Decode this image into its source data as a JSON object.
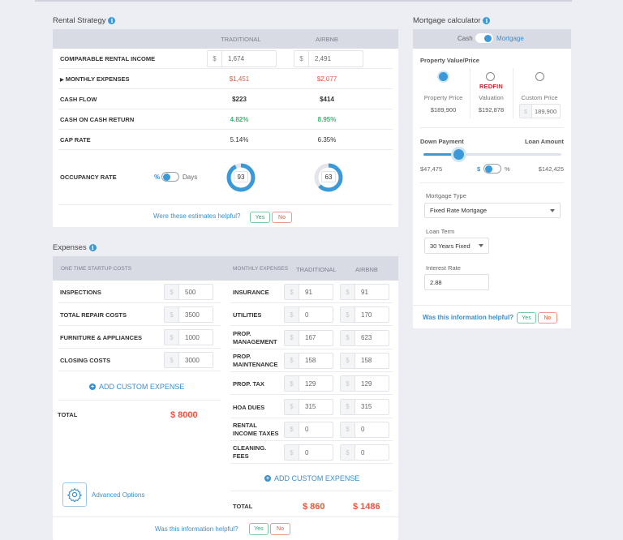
{
  "rental_strategy": {
    "title": "Rental Strategy",
    "col_traditional": "TRADITIONAL",
    "col_airbnb": "AIRBNB",
    "rows": {
      "income": {
        "label": "COMPARABLE RENTAL INCOME",
        "currency": "$",
        "traditional": "1,674",
        "airbnb": "2,491"
      },
      "expenses": {
        "label": "MONTHLY EXPENSES",
        "traditional": "$1,451",
        "airbnb": "$2,077"
      },
      "cashflow": {
        "label": "CASH FLOW",
        "traditional": "$223",
        "airbnb": "$414"
      },
      "coc": {
        "label": "CASH ON CASH RETURN",
        "traditional": "4.82%",
        "airbnb": "8.95%"
      },
      "cap": {
        "label": "CAP RATE",
        "traditional": "5.14%",
        "airbnb": "6.35%"
      },
      "occupancy": {
        "label": "OCCUPANCY RATE",
        "toggle_left": "%",
        "toggle_right": "Days",
        "traditional": "93",
        "airbnb": "63",
        "traditional_pct": 93,
        "airbnb_pct": 63
      }
    },
    "helpful_text": "Were these estimates helpful?",
    "yes": "Yes",
    "no": "No"
  },
  "expenses": {
    "title": "Expenses",
    "startup_header": "ONE TIME STARTUP COSTS",
    "monthly_header": "MONTHLY EXPENSES",
    "col_traditional": "TRADITIONAL",
    "col_airbnb": "AIRBNB",
    "currency": "$",
    "startup": [
      {
        "label": "INSPECTIONS",
        "value": "500"
      },
      {
        "label": "TOTAL REPAIR COSTS",
        "value": "3500"
      },
      {
        "label": "FURNITURE & APPLIANCES",
        "value": "1000"
      },
      {
        "label": "CLOSING COSTS",
        "value": "3000"
      }
    ],
    "monthly": [
      {
        "label": "INSURANCE",
        "traditional": "91",
        "airbnb": "91"
      },
      {
        "label": "UTILITIES",
        "traditional": "0",
        "airbnb": "170"
      },
      {
        "label": "PROP. MANAGEMENT",
        "traditional": "167",
        "airbnb": "623"
      },
      {
        "label": "PROP. MAINTENANCE",
        "traditional": "158",
        "airbnb": "158"
      },
      {
        "label": "PROP. TAX",
        "traditional": "129",
        "airbnb": "129"
      },
      {
        "label": "HOA DUES",
        "traditional": "315",
        "airbnb": "315"
      },
      {
        "label": "RENTAL INCOME TAXES",
        "traditional": "0",
        "airbnb": "0"
      },
      {
        "label": "CLEANING. FEES",
        "traditional": "0",
        "airbnb": "0"
      }
    ],
    "add_custom": "ADD CUSTOM EXPENSE",
    "total_label": "TOTAL",
    "startup_total": "$ 8000",
    "monthly_total_traditional": "$ 860",
    "monthly_total_airbnb": "$ 1486",
    "advanced_options": "Advanced Options",
    "helpful_text": "Was this information helpful?",
    "yes": "Yes",
    "no": "No"
  },
  "mortgage": {
    "title": "Mortgage calculator",
    "toggle_left": "Cash",
    "toggle_right": "Mortgage",
    "property_value_label": "Property Value/Price",
    "options": [
      {
        "label": "Property Price",
        "value": "$189,900",
        "selected": true
      },
      {
        "label": "Valuation",
        "brand": "REDFIN",
        "value": "$192,878",
        "selected": false
      },
      {
        "label": "Custom Price",
        "currency": "$",
        "value": "189,900",
        "selected": false
      }
    ],
    "down_payment_label": "Down Payment",
    "loan_amount_label": "Loan Amount",
    "down_payment_value": "$47,475",
    "loan_amount_value": "$142,425",
    "down_payment_fraction": 0.25,
    "unit_left": "$",
    "unit_right": "%",
    "mortgage_type_label": "Mortgage Type",
    "mortgage_type_value": "Fixed Rate Mortgage",
    "loan_term_label": "Loan Term",
    "loan_term_value": "30 Years Fixed",
    "interest_rate_label": "Interest Rate",
    "interest_rate_value": "2.88",
    "helpful_text": "Was this information helpful?",
    "yes": "Yes",
    "no": "No"
  },
  "colors": {
    "accent": "#3a9ad9",
    "negative": "#e8563f",
    "positive": "#2fba75"
  }
}
